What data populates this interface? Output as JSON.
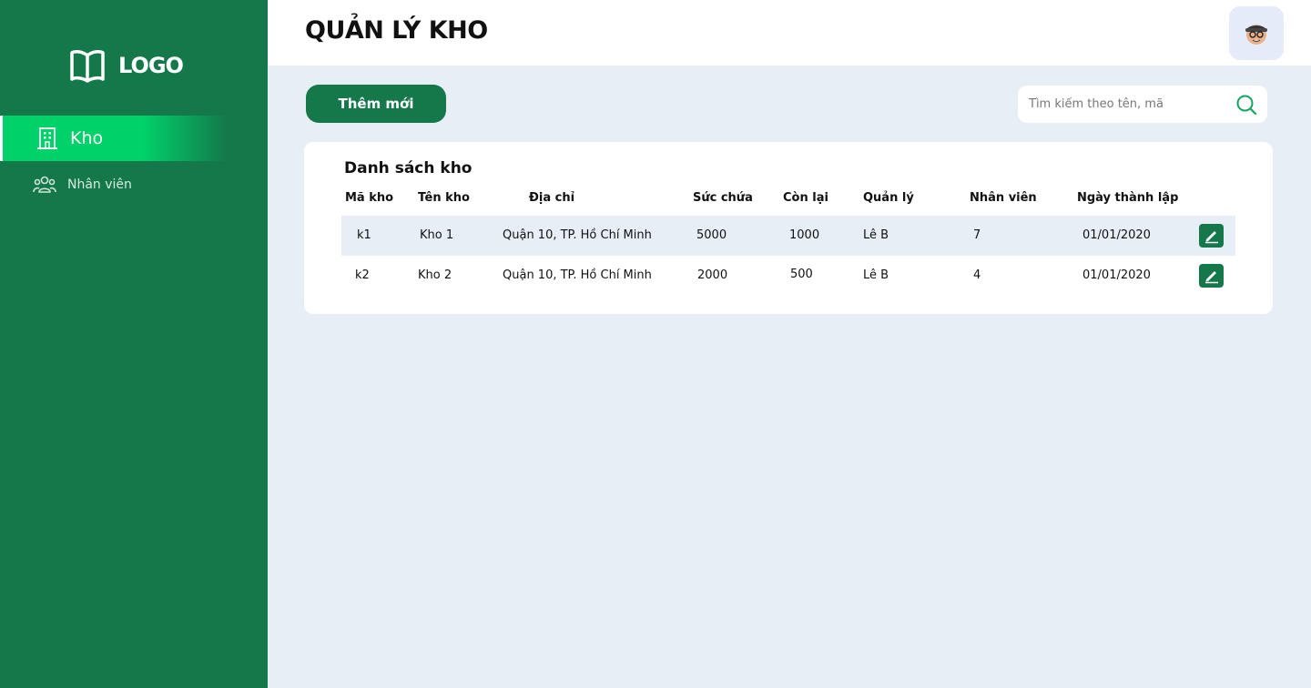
{
  "sidebar": {
    "logo_text": "LOGO",
    "items": [
      {
        "label": "Kho",
        "icon": "building-icon",
        "active": true
      },
      {
        "label": "Nhân viên",
        "icon": "users-icon",
        "active": false
      }
    ]
  },
  "header": {
    "title": "QUẢN LÝ KHO",
    "avatar": "avatar"
  },
  "toolbar": {
    "add_label": "Thêm mới",
    "search_placeholder": "Tìm kiếm theo tên, mã"
  },
  "table": {
    "title": "Danh sách kho",
    "columns": [
      "Mã kho",
      "Tên kho",
      "Địa chỉ",
      "Sức chứa",
      "Còn lại",
      "Quản lý",
      "Nhân viên",
      "Ngày thành lập"
    ],
    "rows": [
      [
        "k1",
        "Kho 1",
        "Quận 10, TP. Hồ Chí Minh",
        "5000",
        "1000",
        "Lê B",
        "7",
        "01/01/2020"
      ],
      [
        "k2",
        "Kho 2",
        "Quận 10, TP. Hồ Chí Minh",
        "2000",
        "500",
        "Lê B",
        "4",
        "01/01/2020"
      ]
    ]
  },
  "colors": {
    "primary": "#14784b",
    "accent": "#00d26a",
    "background": "#e8eef6"
  }
}
